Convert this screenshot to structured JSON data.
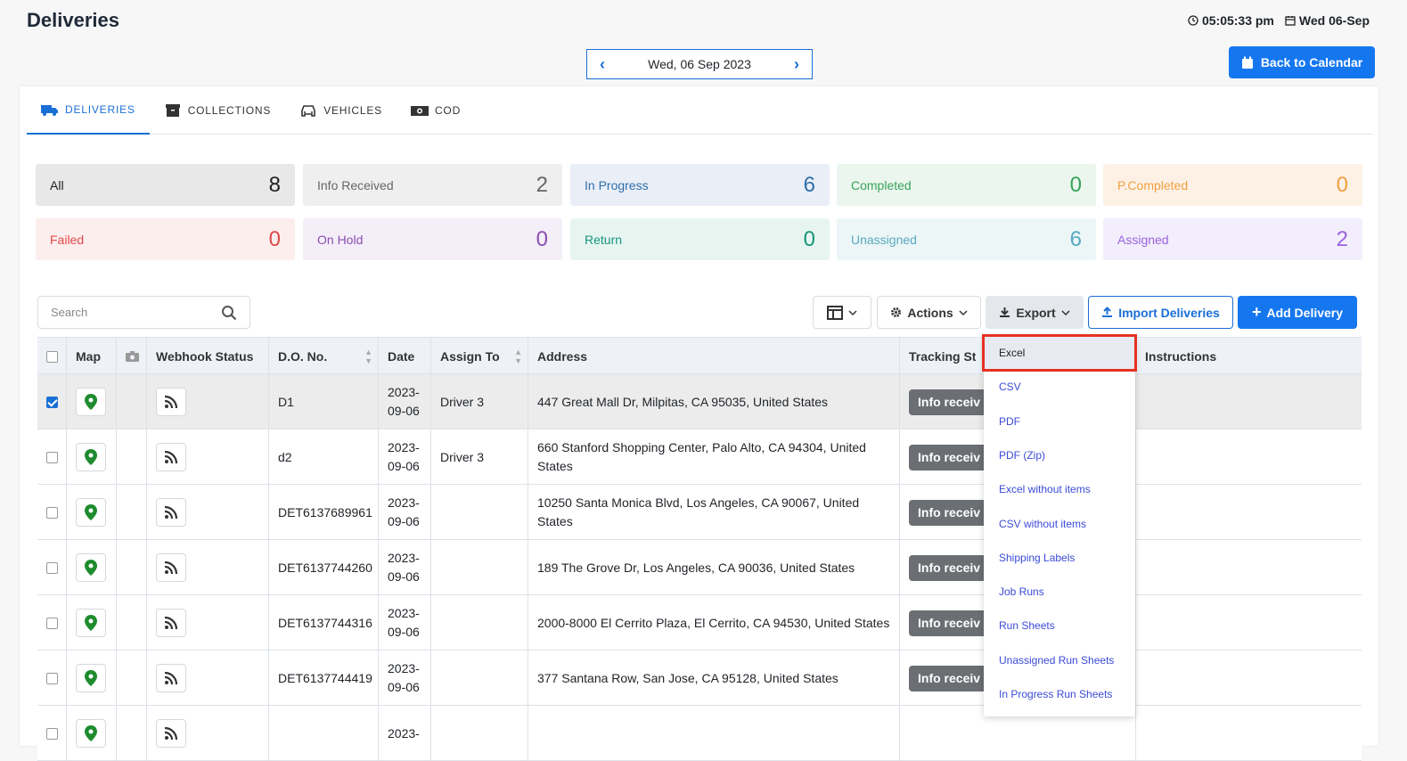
{
  "header": {
    "title": "Deliveries",
    "time": "05:05:33 pm",
    "date_short": "Wed 06-Sep",
    "date_nav": "Wed, 06 Sep 2023",
    "back_button": "Back to Calendar"
  },
  "tabs": [
    {
      "label": "DELIVERIES",
      "icon": "truck-icon",
      "active": true
    },
    {
      "label": "COLLECTIONS",
      "icon": "archive-icon",
      "active": false
    },
    {
      "label": "VEHICLES",
      "icon": "car-icon",
      "active": false
    },
    {
      "label": "COD",
      "icon": "money-icon",
      "active": false
    }
  ],
  "stats": [
    {
      "label": "All",
      "count": "8",
      "bg": "#e8e8e8",
      "color": "#222222"
    },
    {
      "label": "Info Received",
      "count": "2",
      "bg": "#efefef",
      "color": "#666666"
    },
    {
      "label": "In Progress",
      "count": "6",
      "bg": "#e9eef7",
      "color": "#2f6fa8"
    },
    {
      "label": "Completed",
      "count": "0",
      "bg": "#eaf6ee",
      "color": "#3aa35a"
    },
    {
      "label": "P.Completed",
      "count": "0",
      "bg": "#fdf1e6",
      "color": "#f0a040"
    },
    {
      "label": "Failed",
      "count": "0",
      "bg": "#fdeeee",
      "color": "#e04848"
    },
    {
      "label": "On Hold",
      "count": "0",
      "bg": "#f4eef8",
      "color": "#8a4fb0"
    },
    {
      "label": "Return",
      "count": "0",
      "bg": "#e7f5f1",
      "color": "#16957a"
    },
    {
      "label": "Unassigned",
      "count": "6",
      "bg": "#ecf6f6",
      "color": "#58a8c0"
    },
    {
      "label": "Assigned",
      "count": "2",
      "bg": "#f2eefb",
      "color": "#9a62e0"
    }
  ],
  "toolbar": {
    "search_placeholder": "Search",
    "actions_label": "Actions",
    "export_label": "Export",
    "import_label": "Import Deliveries",
    "add_label": "Add Delivery"
  },
  "columns": [
    "Map",
    "Webhook Status",
    "D.O. No.",
    "Date",
    "Assign To",
    "Address",
    "Tracking St",
    "Instructions"
  ],
  "rows": [
    {
      "do_no": "D1",
      "date1": "2023-",
      "date2": "09-06",
      "assign": "Driver 3",
      "address": "447 Great Mall Dr, Milpitas, CA 95035, United States",
      "status": "Info receiv",
      "checked": true
    },
    {
      "do_no": "d2",
      "date1": "2023-",
      "date2": "09-06",
      "assign": "Driver 3",
      "address": "660 Stanford Shopping Center, Palo Alto, CA 94304, United States",
      "status": "Info receiv",
      "checked": false
    },
    {
      "do_no": "DET6137689961",
      "date1": "2023-",
      "date2": "09-06",
      "assign": "",
      "address": "10250 Santa Monica Blvd, Los Angeles, CA 90067, United States",
      "status": "Info receiv",
      "checked": false
    },
    {
      "do_no": "DET6137744260",
      "date1": "2023-",
      "date2": "09-06",
      "assign": "",
      "address": "189 The Grove Dr, Los Angeles, CA 90036, United States",
      "status": "Info receiv",
      "checked": false
    },
    {
      "do_no": "DET6137744316",
      "date1": "2023-",
      "date2": "09-06",
      "assign": "",
      "address": "2000-8000 El Cerrito Plaza, El Cerrito, CA 94530, United States",
      "status": "Info receiv",
      "checked": false
    },
    {
      "do_no": "DET6137744419",
      "date1": "2023-",
      "date2": "09-06",
      "assign": "",
      "address": "377 Santana Row, San Jose, CA 95128, United States",
      "status": "Info receiv",
      "checked": false
    },
    {
      "do_no": "",
      "date1": "2023-",
      "date2": "",
      "assign": "",
      "address": "",
      "status": "",
      "checked": false
    }
  ],
  "export_menu": [
    "Excel",
    "CSV",
    "PDF",
    "PDF (Zip)",
    "Excel without items",
    "CSV without items",
    "Shipping Labels",
    "Job Runs",
    "Run Sheets",
    "Unassigned Run Sheets",
    "In Progress Run Sheets"
  ]
}
